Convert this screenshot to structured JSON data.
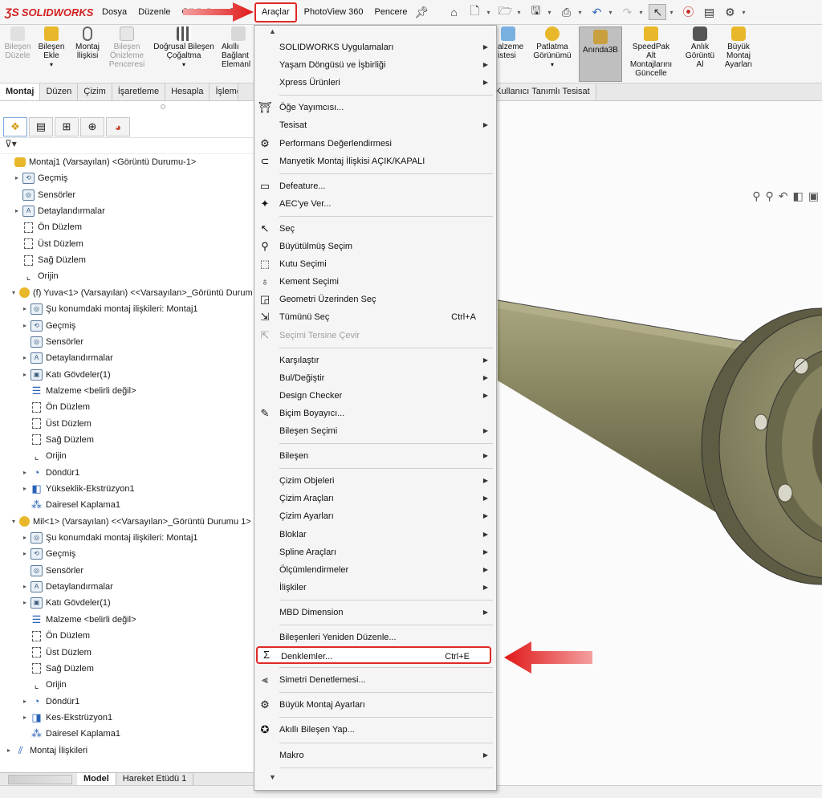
{
  "app": {
    "logo_text": "SOLIDWORKS",
    "menu": [
      "Dosya",
      "Düzenle",
      "Görünüm",
      "Ekle",
      "Araçlar",
      "PhotoView 360",
      "Pencere"
    ],
    "active_menu": "Araçlar"
  },
  "commands": [
    {
      "label": "Bileşen\nDüzele",
      "disabled": true
    },
    {
      "label": "Bileşen\nEkle",
      "disabled": false
    },
    {
      "label": "Montaj\nİlişkisi",
      "disabled": false
    },
    {
      "label": "Bileşen\nÖnizleme\nPenceresi",
      "disabled": true
    },
    {
      "label": "Doğrusal Bileşen\nÇoğaltma",
      "disabled": false
    },
    {
      "label": "Akıllı\nBağlant\nElemanl",
      "disabled": false
    },
    {
      "label": "alzeme\nistesi",
      "disabled": false
    },
    {
      "label": "Patlatma\nGörünümü",
      "disabled": false
    },
    {
      "label": "Anında3B",
      "disabled": false,
      "selected": true
    },
    {
      "label": "SpeedPak\nAlt\nMontajlarını\nGüncelle",
      "disabled": false
    },
    {
      "label": "Anlık\nGörüntü\nAl",
      "disabled": false
    },
    {
      "label": "Büyük\nMontaj\nAyarları",
      "disabled": false
    }
  ],
  "tabs": [
    "Montaj",
    "Düzen",
    "Çizim",
    "İşaretleme",
    "Hesapla",
    "İşleme",
    "ller",
    "Kullanıcı Tanımlı Tesisat"
  ],
  "active_tab": "Montaj",
  "tree": [
    {
      "label": "Montaj1 (Varsayılan) <Görüntü Durumu-1>",
      "indent": 0,
      "exp": "",
      "icon": "asm"
    },
    {
      "label": "Geçmiş",
      "indent": 1,
      "exp": "▸",
      "icon": "box",
      "sym": "⟲"
    },
    {
      "label": "Sensörler",
      "indent": 1,
      "exp": "",
      "icon": "box",
      "sym": "◎"
    },
    {
      "label": "Detaylandırmalar",
      "indent": 1,
      "exp": "▸",
      "icon": "box",
      "sym": "A"
    },
    {
      "label": "Ön Düzlem",
      "indent": 1,
      "exp": "",
      "icon": "plane"
    },
    {
      "label": "Üst Düzlem",
      "indent": 1,
      "exp": "",
      "icon": "plane"
    },
    {
      "label": "Sağ Düzlem",
      "indent": 1,
      "exp": "",
      "icon": "plane"
    },
    {
      "label": "Orijin",
      "indent": 1,
      "exp": "",
      "icon": "origin",
      "sym": "⌞"
    },
    {
      "label": "(f) Yuva<1> (Varsayılan) <<Varsayılan>_Görüntü Durum",
      "indent": 0.6,
      "exp": "▾",
      "icon": "part"
    },
    {
      "label": "Şu konumdaki montaj ilişkileri: Montaj1",
      "indent": 2,
      "exp": "▸",
      "icon": "box",
      "sym": "◎"
    },
    {
      "label": "Geçmiş",
      "indent": 2,
      "exp": "▸",
      "icon": "box",
      "sym": "⟲"
    },
    {
      "label": "Sensörler",
      "indent": 2,
      "exp": "",
      "icon": "box",
      "sym": "◎"
    },
    {
      "label": "Detaylandırmalar",
      "indent": 2,
      "exp": "▸",
      "icon": "box",
      "sym": "A"
    },
    {
      "label": "Katı Gövdeler(1)",
      "indent": 2,
      "exp": "▸",
      "icon": "box",
      "sym": "▣"
    },
    {
      "label": "Malzeme <belirli değil>",
      "indent": 2,
      "exp": "",
      "icon": "blue",
      "sym": "☰"
    },
    {
      "label": "Ön Düzlem",
      "indent": 2,
      "exp": "",
      "icon": "plane"
    },
    {
      "label": "Üst Düzlem",
      "indent": 2,
      "exp": "",
      "icon": "plane"
    },
    {
      "label": "Sağ Düzlem",
      "indent": 2,
      "exp": "",
      "icon": "plane"
    },
    {
      "label": "Orijin",
      "indent": 2,
      "exp": "",
      "icon": "origin",
      "sym": "⌞"
    },
    {
      "label": "Döndür1",
      "indent": 2,
      "exp": "▸",
      "icon": "blue",
      "sym": "◔"
    },
    {
      "label": "Yükseklik-Ekstrüzyon1",
      "indent": 2,
      "exp": "▸",
      "icon": "blue",
      "sym": "◧"
    },
    {
      "label": "Dairesel Kaplama1",
      "indent": 2,
      "exp": "",
      "icon": "blue",
      "sym": "⁂"
    },
    {
      "label": "Mil<1> (Varsayılan) <<Varsayılan>_Görüntü Durumu 1>",
      "indent": 0.6,
      "exp": "▾",
      "icon": "part"
    },
    {
      "label": "Şu konumdaki montaj ilişkileri: Montaj1",
      "indent": 2,
      "exp": "▸",
      "icon": "box",
      "sym": "◎"
    },
    {
      "label": "Geçmiş",
      "indent": 2,
      "exp": "▸",
      "icon": "box",
      "sym": "⟲"
    },
    {
      "label": "Sensörler",
      "indent": 2,
      "exp": "",
      "icon": "box",
      "sym": "◎"
    },
    {
      "label": "Detaylandırmalar",
      "indent": 2,
      "exp": "▸",
      "icon": "box",
      "sym": "A"
    },
    {
      "label": "Katı Gövdeler(1)",
      "indent": 2,
      "exp": "▸",
      "icon": "box",
      "sym": "▣"
    },
    {
      "label": "Malzeme <belirli değil>",
      "indent": 2,
      "exp": "",
      "icon": "blue",
      "sym": "☰"
    },
    {
      "label": "Ön Düzlem",
      "indent": 2,
      "exp": "",
      "icon": "plane"
    },
    {
      "label": "Üst Düzlem",
      "indent": 2,
      "exp": "",
      "icon": "plane"
    },
    {
      "label": "Sağ Düzlem",
      "indent": 2,
      "exp": "",
      "icon": "plane"
    },
    {
      "label": "Orijin",
      "indent": 2,
      "exp": "",
      "icon": "origin",
      "sym": "⌞"
    },
    {
      "label": "Döndür1",
      "indent": 2,
      "exp": "▸",
      "icon": "blue",
      "sym": "◔"
    },
    {
      "label": "Kes-Ekstrüzyon1",
      "indent": 2,
      "exp": "▸",
      "icon": "blue",
      "sym": "◨"
    },
    {
      "label": "Dairesel Kaplama1",
      "indent": 2,
      "exp": "",
      "icon": "blue",
      "sym": "⁂"
    },
    {
      "label": "Montaj İlişkileri",
      "indent": 0,
      "exp": "▸",
      "icon": "blue",
      "sym": "⫽"
    }
  ],
  "bottom_tabs": [
    "Model",
    "Hareket Etüdü 1"
  ],
  "menu_items": [
    {
      "type": "scroll",
      "sym": "▲"
    },
    {
      "type": "item",
      "label": "SOLIDWORKS Uygulamaları",
      "sub": true
    },
    {
      "type": "item",
      "label": "Yaşam Döngüsü ve İşbirliği",
      "sub": true
    },
    {
      "type": "item",
      "label": "Xpress Ürünleri",
      "sub": true
    },
    {
      "type": "sep"
    },
    {
      "type": "item",
      "label": "Öğe Yayımcısı...",
      "icon": "⛩"
    },
    {
      "type": "item",
      "label": "Tesisat",
      "sub": true
    },
    {
      "type": "item",
      "label": "Performans Değerlendirmesi",
      "icon": "⚙"
    },
    {
      "type": "item",
      "label": "Manyetik Montaj İlişkisi AÇIK/KAPALI",
      "icon": "⊂"
    },
    {
      "type": "sep"
    },
    {
      "type": "item",
      "label": "Defeature...",
      "icon": "▭"
    },
    {
      "type": "item",
      "label": "AEC'ye Ver...",
      "icon": "✦"
    },
    {
      "type": "sep"
    },
    {
      "type": "item",
      "label": "Seç",
      "icon": "↖"
    },
    {
      "type": "item",
      "label": "Büyütülmüş Seçim",
      "icon": "⚲"
    },
    {
      "type": "item",
      "label": "Kutu Seçimi",
      "icon": "⬚"
    },
    {
      "type": "item",
      "label": "Kement Seçimi",
      "icon": "♁"
    },
    {
      "type": "item",
      "label": "Geometri Üzerinden Seç",
      "icon": "◲"
    },
    {
      "type": "item",
      "label": "Tümünü Seç",
      "icon": "⇲",
      "shortcut": "Ctrl+A"
    },
    {
      "type": "item",
      "label": "Seçimi Tersine Çevir",
      "icon": "⇱",
      "disabled": true
    },
    {
      "type": "sep"
    },
    {
      "type": "item",
      "label": "Karşılaştır",
      "sub": true
    },
    {
      "type": "item",
      "label": "Bul/Değiştir",
      "sub": true
    },
    {
      "type": "item",
      "label": "Design Checker",
      "sub": true
    },
    {
      "type": "item",
      "label": "Biçim Boyayıcı...",
      "icon": "✎"
    },
    {
      "type": "item",
      "label": "Bileşen Seçimi",
      "sub": true
    },
    {
      "type": "sep"
    },
    {
      "type": "item",
      "label": "Bileşen",
      "sub": true
    },
    {
      "type": "sep"
    },
    {
      "type": "item",
      "label": "Çizim Objeleri",
      "sub": true
    },
    {
      "type": "item",
      "label": "Çizim Araçları",
      "sub": true
    },
    {
      "type": "item",
      "label": "Çizim Ayarları",
      "sub": true
    },
    {
      "type": "item",
      "label": "Bloklar",
      "sub": true
    },
    {
      "type": "item",
      "label": "Spline Araçları",
      "sub": true
    },
    {
      "type": "item",
      "label": "Ölçümlendirmeler",
      "sub": true
    },
    {
      "type": "item",
      "label": "İlişkiler",
      "sub": true
    },
    {
      "type": "sep"
    },
    {
      "type": "item",
      "label": "MBD Dimension",
      "sub": true
    },
    {
      "type": "sep"
    },
    {
      "type": "item",
      "label": "Bileşenleri Yeniden Düzenle..."
    },
    {
      "type": "item",
      "label": "Denklemler...",
      "icon": "Σ",
      "shortcut": "Ctrl+E",
      "highlight": true
    },
    {
      "type": "sep"
    },
    {
      "type": "item",
      "label": "Simetri Denetlemesi...",
      "icon": "⫷"
    },
    {
      "type": "sep"
    },
    {
      "type": "item",
      "label": "Büyük Montaj Ayarları",
      "icon": "⚙"
    },
    {
      "type": "sep"
    },
    {
      "type": "item",
      "label": "Akıllı Bileşen Yap...",
      "icon": "✪"
    },
    {
      "type": "sep"
    },
    {
      "type": "item",
      "label": "Makro",
      "sub": true
    },
    {
      "type": "sep"
    },
    {
      "type": "scroll",
      "sym": "▼"
    }
  ],
  "colors": {
    "highlight_border": "#e02828",
    "logo_red": "#d22020",
    "part_olive": "#8e8a5e"
  }
}
